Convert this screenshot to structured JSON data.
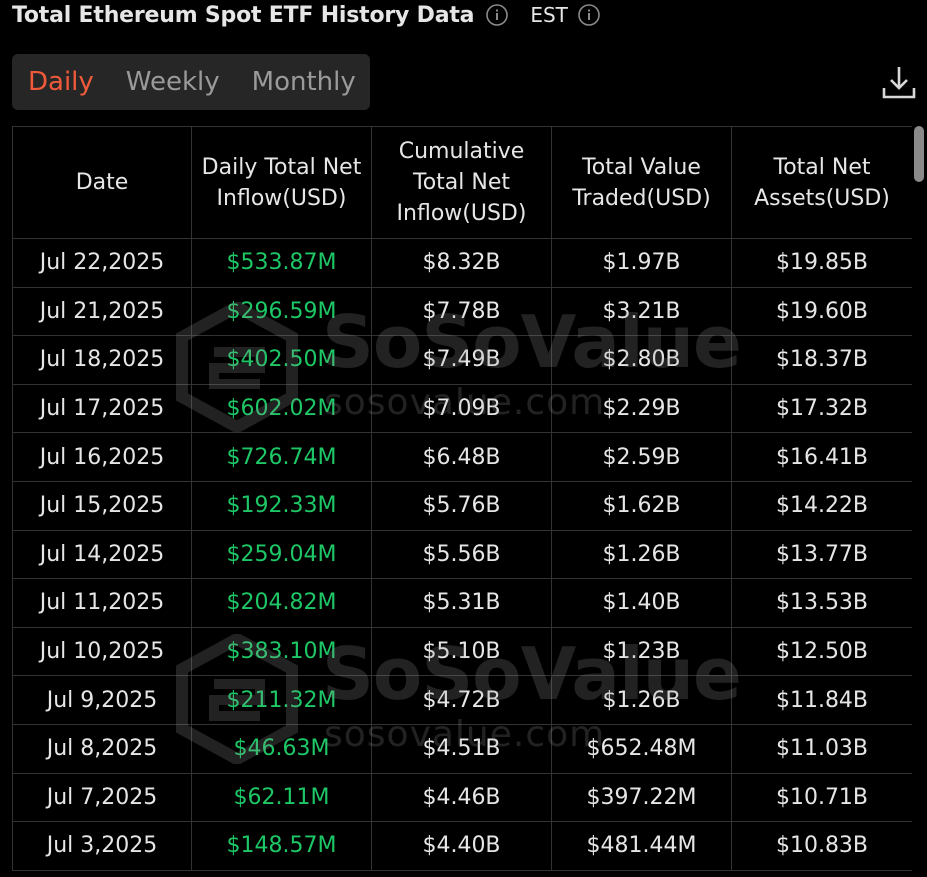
{
  "header": {
    "title": "Total Ethereum Spot ETF History Data",
    "timezone": "EST",
    "info_icon": "info-circle-icon"
  },
  "tabs": [
    {
      "label": "Daily",
      "active": true
    },
    {
      "label": "Weekly",
      "active": false
    },
    {
      "label": "Monthly",
      "active": false
    }
  ],
  "download_icon": "download-icon",
  "table": {
    "columns": [
      "Date",
      "Daily Total Net Inflow(USD)",
      "Cumulative Total Net Inflow(USD)",
      "Total Value Traded(USD)",
      "Total Net Assets(USD)"
    ],
    "rows": [
      [
        "Jul 22,2025",
        "$533.87M",
        "$8.32B",
        "$1.97B",
        "$19.85B"
      ],
      [
        "Jul 21,2025",
        "$296.59M",
        "$7.78B",
        "$3.21B",
        "$19.60B"
      ],
      [
        "Jul 18,2025",
        "$402.50M",
        "$7.49B",
        "$2.80B",
        "$18.37B"
      ],
      [
        "Jul 17,2025",
        "$602.02M",
        "$7.09B",
        "$2.29B",
        "$17.32B"
      ],
      [
        "Jul 16,2025",
        "$726.74M",
        "$6.48B",
        "$2.59B",
        "$16.41B"
      ],
      [
        "Jul 15,2025",
        "$192.33M",
        "$5.76B",
        "$1.62B",
        "$14.22B"
      ],
      [
        "Jul 14,2025",
        "$259.04M",
        "$5.56B",
        "$1.26B",
        "$13.77B"
      ],
      [
        "Jul 11,2025",
        "$204.82M",
        "$5.31B",
        "$1.40B",
        "$13.53B"
      ],
      [
        "Jul 10,2025",
        "$383.10M",
        "$5.10B",
        "$1.23B",
        "$12.50B"
      ],
      [
        "Jul 9,2025",
        "$211.32M",
        "$4.72B",
        "$1.26B",
        "$11.84B"
      ],
      [
        "Jul 8,2025",
        "$46.63M",
        "$4.51B",
        "$652.48M",
        "$11.03B"
      ],
      [
        "Jul 7,2025",
        "$62.11M",
        "$4.46B",
        "$397.22M",
        "$10.71B"
      ],
      [
        "Jul 3,2025",
        "$148.57M",
        "$4.40B",
        "$481.44M",
        "$10.83B"
      ]
    ]
  },
  "watermark": {
    "brand": "SoSoValue",
    "domain": "sosovalue.com"
  },
  "colors": {
    "background": "#000000",
    "active_tab": "#f05a3a",
    "inflow_positive": "#1ec766",
    "tab_bar": "#262626",
    "grid": "#333333"
  }
}
